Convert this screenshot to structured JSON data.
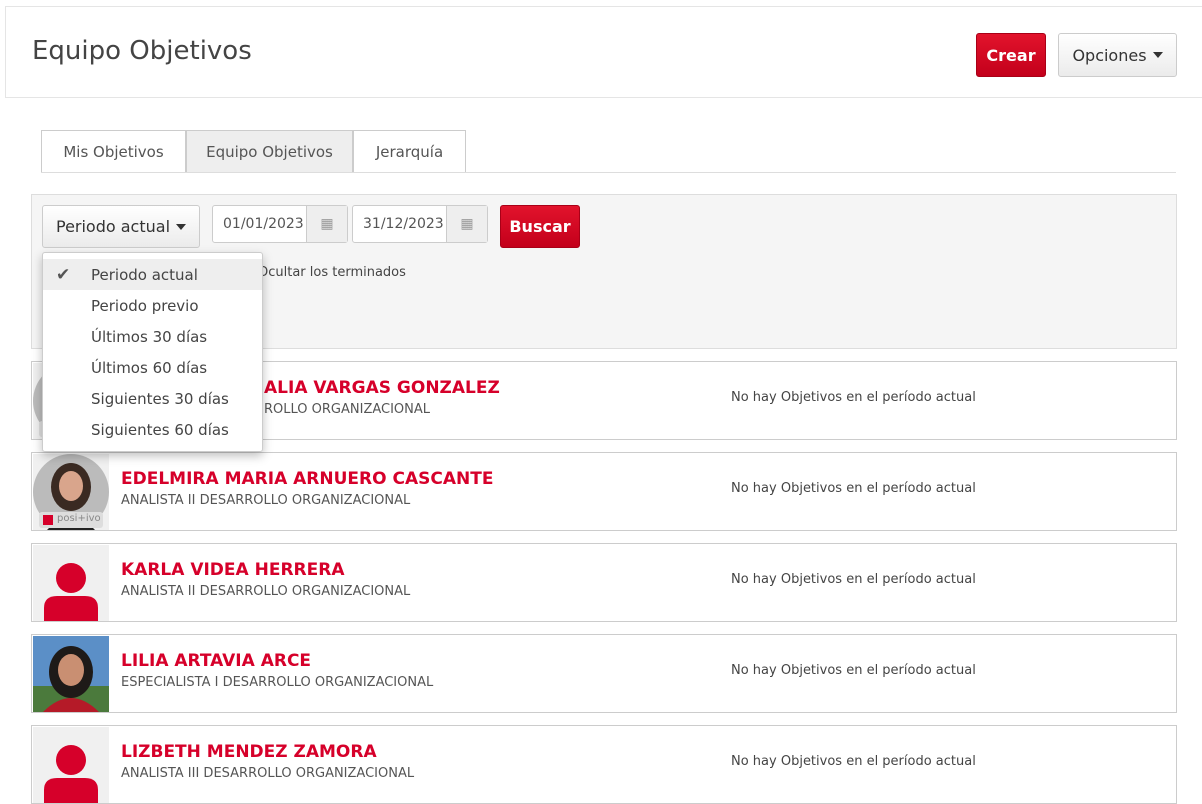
{
  "header": {
    "title": "Equipo Objetivos",
    "create_label": "Crear",
    "options_label": "Opciones"
  },
  "tabs": [
    {
      "label": "Mis Objetivos"
    },
    {
      "label": "Equipo Objetivos",
      "active": true
    },
    {
      "label": "Jerarquía"
    }
  ],
  "filters": {
    "period_label": "Periodo actual",
    "start_date": "01/01/2023",
    "end_date": "31/12/2023",
    "search_label": "Buscar",
    "hide_finished_label": "Ocultar los terminados"
  },
  "period_menu": {
    "selected": "Periodo actual",
    "items": [
      "Periodo actual",
      "Periodo previo",
      "Últimos 30 días",
      "Últimos 60 días",
      "Siguientes 30 días",
      "Siguientes 60 días"
    ]
  },
  "employees": [
    {
      "name": "ALIA VARGAS GONZALEZ",
      "role": "ROLLO ORGANIZACIONAL",
      "message": "No hay Objetivos en el período actual"
    },
    {
      "name": "EDELMIRA MARIA ARNUERO CASCANTE",
      "role": "ANALISTA II DESARROLLO ORGANIZACIONAL",
      "message": "No hay Objetivos en el período actual",
      "badge": "posi+ivo"
    },
    {
      "name": "KARLA VIDEA HERRERA",
      "role": "ANALISTA II DESARROLLO ORGANIZACIONAL",
      "message": "No hay Objetivos en el período actual"
    },
    {
      "name": "LILIA ARTAVIA ARCE",
      "role": "ESPECIALISTA I DESARROLLO ORGANIZACIONAL",
      "message": "No hay Objetivos en el período actual"
    },
    {
      "name": "LIZBETH MENDEZ ZAMORA",
      "role": "ANALISTA III DESARROLLO ORGANIZACIONAL",
      "message": "No hay Objetivos en el período actual"
    }
  ],
  "colors": {
    "accent": "#d6002a",
    "panel": "#f5f5f5"
  }
}
